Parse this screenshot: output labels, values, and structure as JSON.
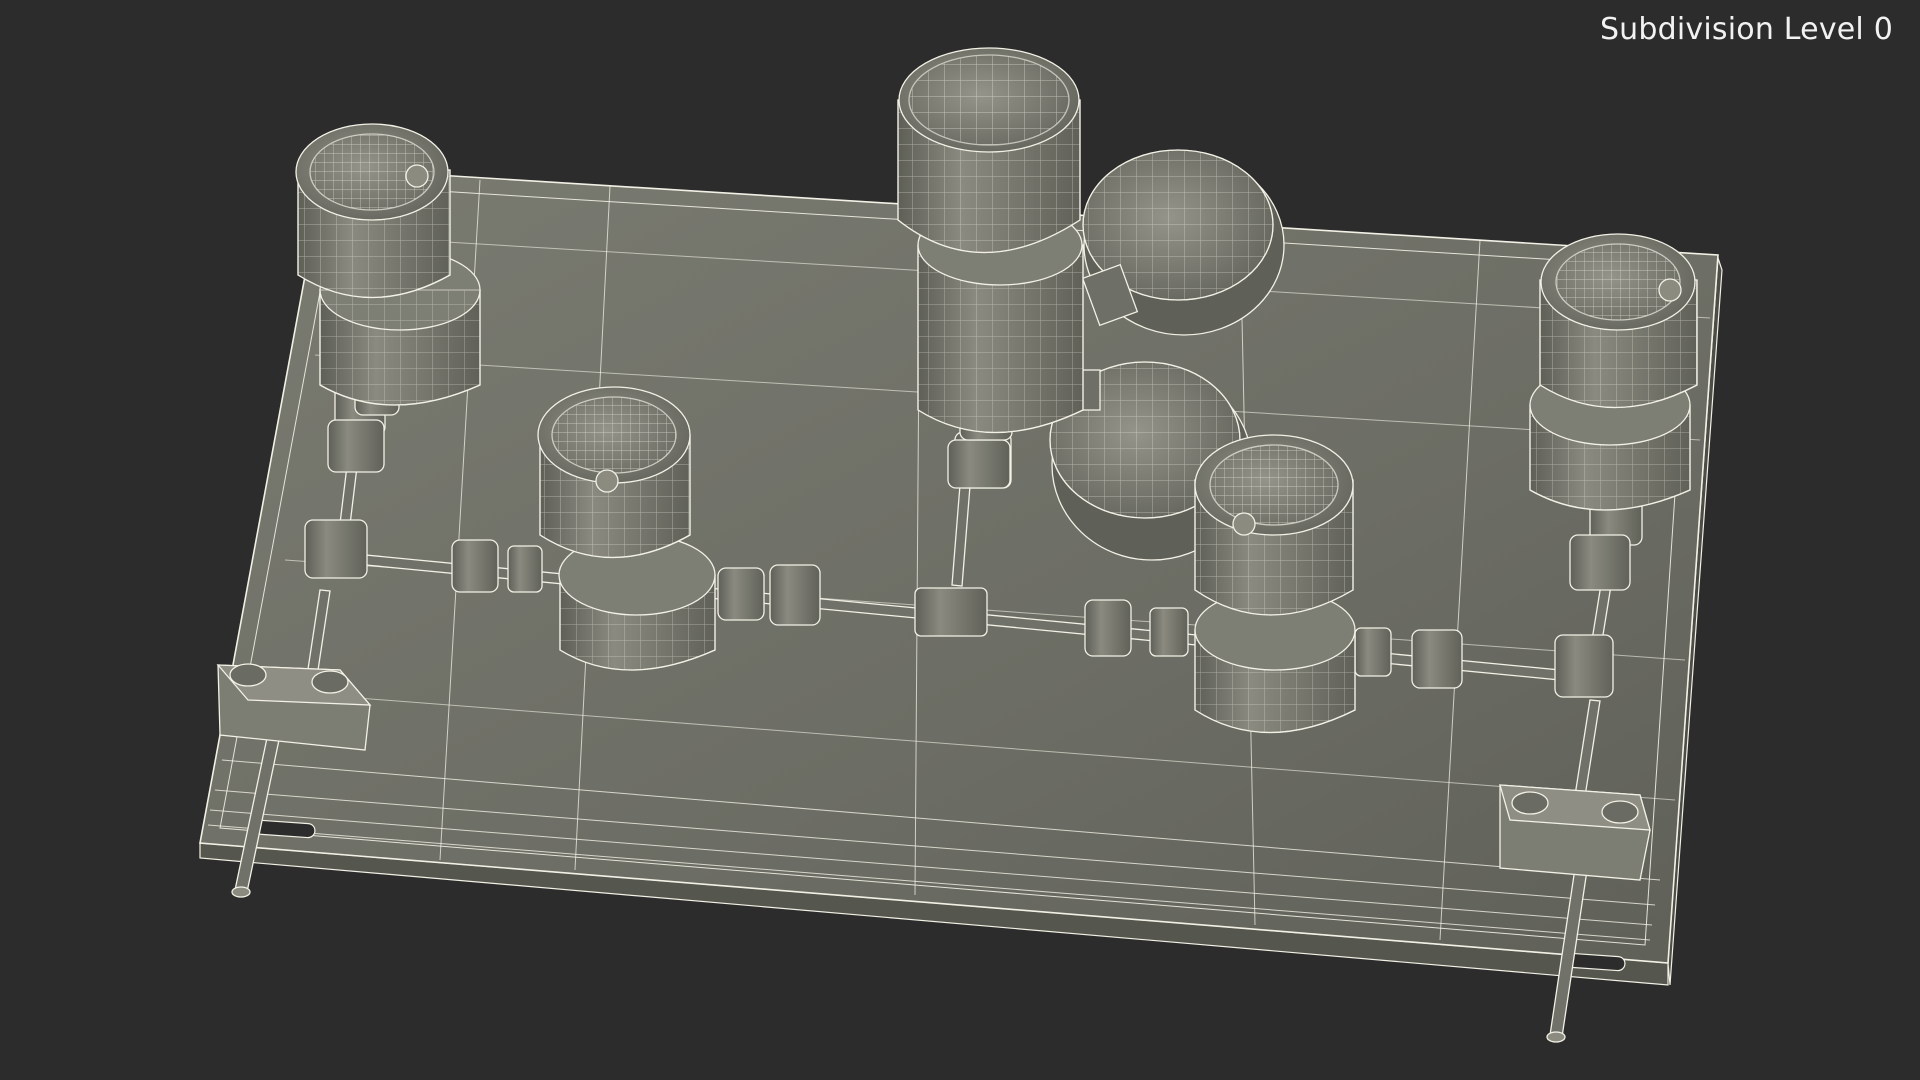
{
  "viewport": {
    "overlay_label": "Subdivision Level 0",
    "colors": {
      "background": "#2b2c2b",
      "surface": "#6e6f66",
      "surface_dark": "#55564e",
      "surface_light": "#8b8b80",
      "wire": "#f3f1e6",
      "label_text": "#f2f2f2"
    },
    "subject_icon": "wireframe-gas-panel-model"
  }
}
